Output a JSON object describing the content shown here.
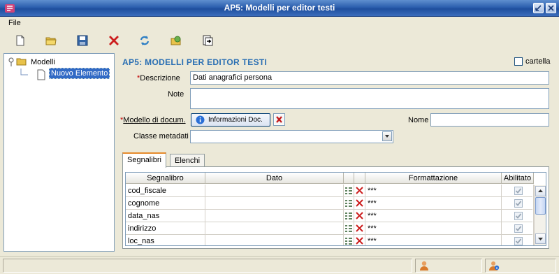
{
  "window": {
    "title": "AP5: Modelli per editor testi"
  },
  "menu": {
    "items": [
      "File"
    ]
  },
  "toolbar": {
    "tools": [
      "new-document-icon",
      "open-folder-icon",
      "save-icon",
      "delete-icon",
      "refresh-icon",
      "settings-icon",
      "export-icon"
    ]
  },
  "tree": {
    "root_label": "Modelli",
    "child_label": "Nuovo Elemento"
  },
  "form": {
    "heading": "AP5: MODELLI PER EDITOR TESTI",
    "cartella_label": "cartella",
    "required_mark": "*",
    "descrizione_label": "Descrizione",
    "descrizione_value": "Dati anagrafici persona",
    "note_label": "Note",
    "note_value": "",
    "modello_label": "Modello di docum.",
    "modello_button": "Informazioni Doc.",
    "nome_label": "Nome",
    "nome_value": "",
    "classe_label": "Classe metadati",
    "classe_value": ""
  },
  "tabs": [
    "Segnalibri",
    "Elenchi"
  ],
  "grid": {
    "headers": [
      "Segnalibro",
      "Dato",
      "Formattazione",
      "Abilitato"
    ],
    "rows": [
      {
        "segnalibro": "cod_fiscale",
        "dato": "",
        "formattazione": "***",
        "abilitato": true
      },
      {
        "segnalibro": "cognome",
        "dato": "",
        "formattazione": "***",
        "abilitato": true
      },
      {
        "segnalibro": "data_nas",
        "dato": "",
        "formattazione": "***",
        "abilitato": true
      },
      {
        "segnalibro": "indirizzo",
        "dato": "",
        "formattazione": "***",
        "abilitato": true
      },
      {
        "segnalibro": "loc_nas",
        "dato": "",
        "formattazione": "***",
        "abilitato": true
      }
    ]
  },
  "colors": {
    "title_bar": "#2c5fae",
    "heading": "#2a6fb3",
    "required": "#c00000",
    "selection": "#316ac5"
  }
}
